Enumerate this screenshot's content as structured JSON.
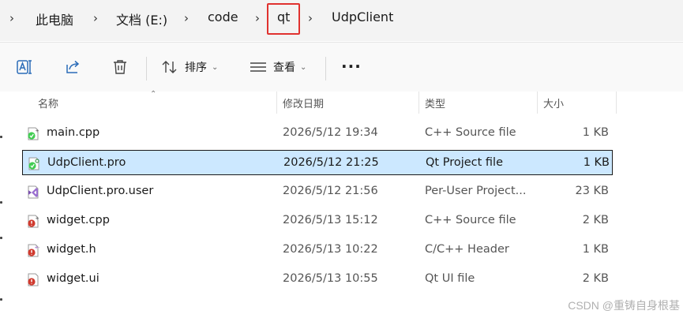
{
  "breadcrumb": {
    "segments": [
      "此电脑",
      "文档 (E:)",
      "code",
      "qt",
      "UdpClient"
    ],
    "separator": "›"
  },
  "toolbar": {
    "rename_icon": "rename-icon",
    "share_icon": "share-icon",
    "delete_icon": "trash-icon",
    "sort_label": "排序",
    "view_label": "查看",
    "more_label": "···"
  },
  "columns": {
    "name": "名称",
    "date": "修改日期",
    "type": "类型",
    "size": "大小"
  },
  "files": [
    {
      "name": "main.cpp",
      "date": "2026/5/12 19:34",
      "type": "C++ Source file",
      "size": "1 KB",
      "icon": "qt-cpp-source-icon",
      "selected": false
    },
    {
      "name": "UdpClient.pro",
      "date": "2026/5/12 21:25",
      "type": "Qt Project file",
      "size": "1 KB",
      "icon": "qt-project-icon",
      "selected": true
    },
    {
      "name": "UdpClient.pro.user",
      "date": "2026/5/12 21:56",
      "type": "Per-User Project...",
      "size": "23 KB",
      "icon": "qt-user-project-icon",
      "selected": false
    },
    {
      "name": "widget.cpp",
      "date": "2026/5/13 15:12",
      "type": "C++ Source file",
      "size": "2 KB",
      "icon": "cpp-source-icon",
      "selected": false
    },
    {
      "name": "widget.h",
      "date": "2026/5/13 10:22",
      "type": "C/C++ Header",
      "size": "1 KB",
      "icon": "cpp-header-icon",
      "selected": false
    },
    {
      "name": "widget.ui",
      "date": "2026/5/13 10:55",
      "type": "Qt UI file",
      "size": "2 KB",
      "icon": "qt-ui-icon",
      "selected": false
    }
  ],
  "colors": {
    "selection_bg": "#cce8ff",
    "highlight_box": "#e0322f",
    "qt_green": "#41cd52",
    "cpp_red": "#d03a2e"
  },
  "watermark": "CSDN @重铸自身根基"
}
